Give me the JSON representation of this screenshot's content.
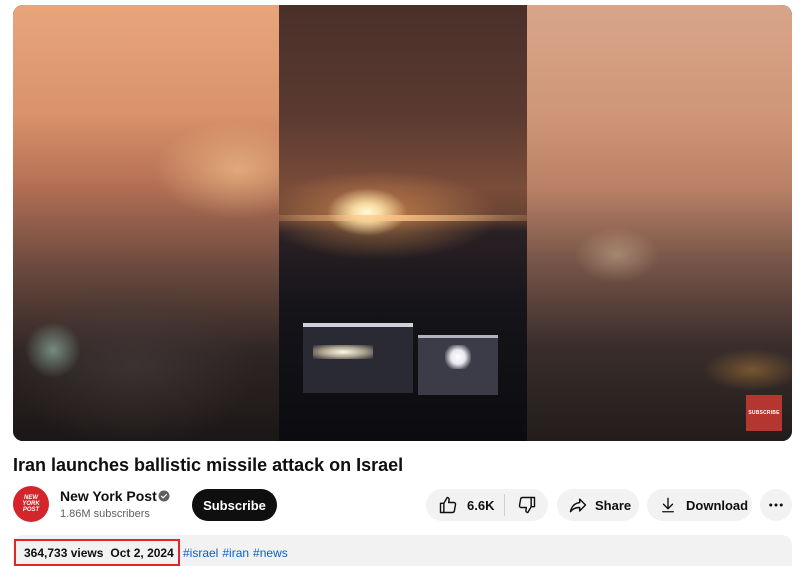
{
  "video": {
    "title": "Iran launches ballistic missile attack on Israel",
    "watermark_label": "SUBSCRIBE"
  },
  "channel": {
    "name": "New York Post",
    "subscribers": "1.86M subscribers",
    "avatar_text": [
      "NEW",
      "YORK",
      "POST"
    ],
    "verified": true
  },
  "actions": {
    "subscribe_label": "Subscribe",
    "like_count": "6.6K",
    "share_label": "Share",
    "download_label": "Download"
  },
  "description": {
    "views": "364,733 views",
    "date": "Oct 2, 2024",
    "hashtags": [
      "#israel",
      "#iran",
      "#news"
    ]
  },
  "colors": {
    "subscribe_bg": "#0f0f0f",
    "pill_bg": "#f2f2f2",
    "hashtag": "#065fd4",
    "highlight": "#e0262b",
    "avatar_bg": "#d3252c"
  },
  "icons": {
    "verified": "verified-check-icon",
    "like": "thumbs-up-icon",
    "dislike": "thumbs-down-icon",
    "share": "share-arrow-icon",
    "download": "download-arrow-icon",
    "more": "more-horizontal-icon"
  }
}
